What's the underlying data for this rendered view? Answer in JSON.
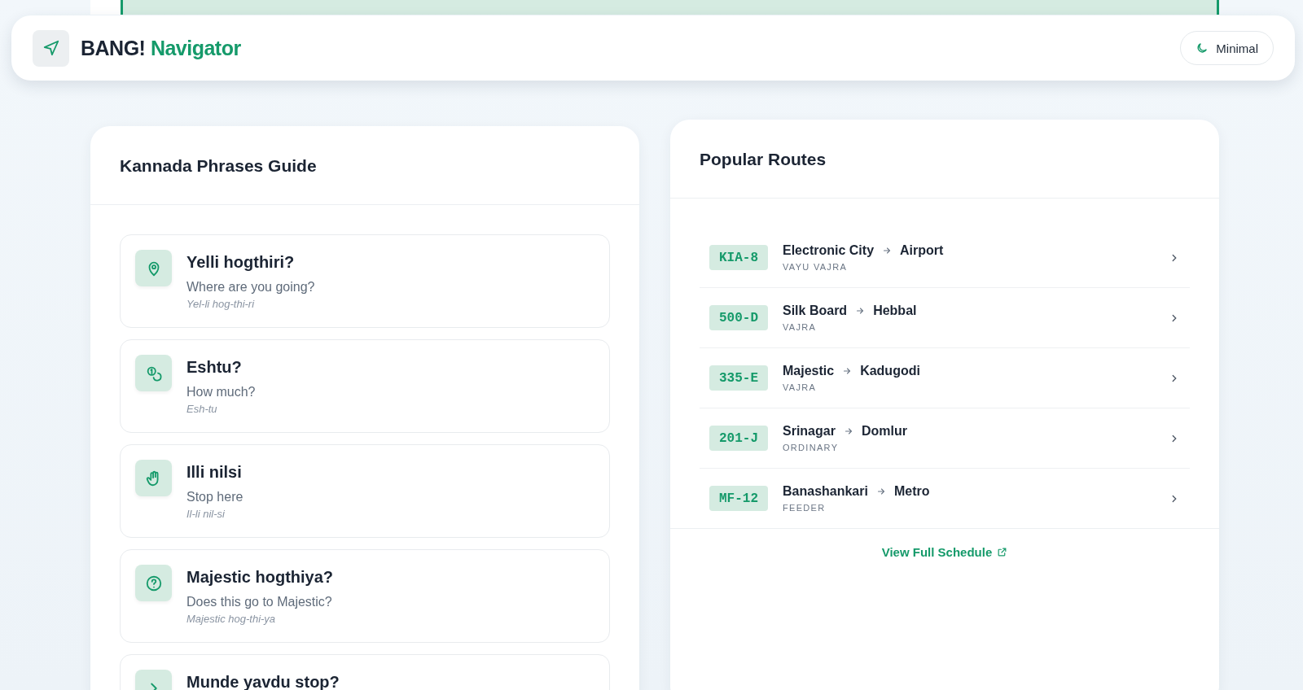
{
  "header": {
    "brand": "BANG!",
    "brand_accent": "Navigator",
    "theme_button": "Minimal"
  },
  "phrases": {
    "title": "Kannada Phrases Guide",
    "items": [
      {
        "kind": "location",
        "phrase": "Yelli hogthiri?",
        "meaning": "Where are you going?",
        "pronunciation": "Yel-li hog-thi-ri"
      },
      {
        "kind": "coins",
        "phrase": "Eshtu?",
        "meaning": "How much?",
        "pronunciation": "Esh-tu"
      },
      {
        "kind": "hand",
        "phrase": "Illi nilsi",
        "meaning": "Stop here",
        "pronunciation": "Il-li nil-si"
      },
      {
        "kind": "question",
        "phrase": "Majestic hogthiya?",
        "meaning": "Does this go to Majestic?",
        "pronunciation": "Majestic hog-thi-ya"
      },
      {
        "kind": "arrow",
        "phrase": "Munde yavdu stop?"
      }
    ]
  },
  "routes": {
    "title": "Popular Routes",
    "items": [
      {
        "code": "KIA-8",
        "from": "Electronic City",
        "to": "Airport",
        "service": "VAYU VAJRA"
      },
      {
        "code": "500-D",
        "from": "Silk Board",
        "to": "Hebbal",
        "service": "VAJRA"
      },
      {
        "code": "335-E",
        "from": "Majestic",
        "to": "Kadugodi",
        "service": "VAJRA"
      },
      {
        "code": "201-J",
        "from": "Srinagar",
        "to": "Domlur",
        "service": "ORDINARY"
      },
      {
        "code": "MF-12",
        "from": "Banashankari",
        "to": "Metro",
        "service": "FEEDER"
      }
    ],
    "link": "View Full Schedule"
  }
}
